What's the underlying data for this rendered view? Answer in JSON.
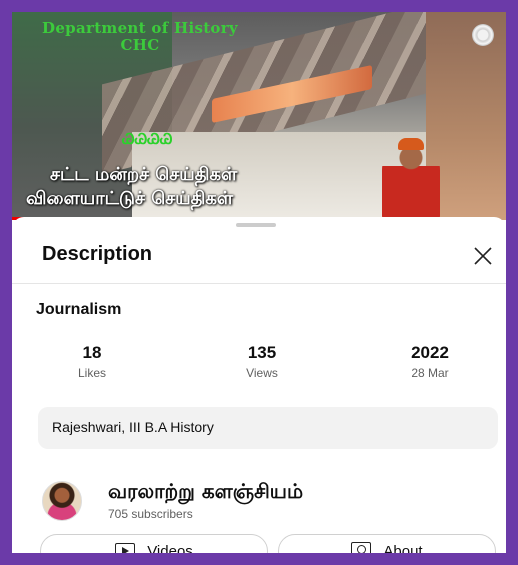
{
  "video": {
    "overlay_dept_line1": "Department of History",
    "overlay_dept_line2": "CHC",
    "overlay_caption_line1": "சட்ட மன்றச் செய்திகள்",
    "overlay_caption_line2": "விளையாட்டுச் செய்திகள்",
    "progress_fraction": 0.22
  },
  "sheet": {
    "title": "Description",
    "close_icon": "close-icon",
    "video_title": "Journalism",
    "stats": [
      {
        "value": "18",
        "label": "Likes"
      },
      {
        "value": "135",
        "label": "Views"
      },
      {
        "value": "2022",
        "label": "28 Mar"
      }
    ],
    "description_text": "Rajeshwari, III B.A History",
    "channel": {
      "name": "வரலாற்று களஞ்சியம்",
      "subscribers": "705 subscribers"
    },
    "buttons": {
      "videos_label": "Videos",
      "about_label": "About"
    }
  },
  "colors": {
    "frame": "#6b3aa8",
    "overlay_green": "#2ad12a",
    "progress_red": "#ee0000"
  }
}
